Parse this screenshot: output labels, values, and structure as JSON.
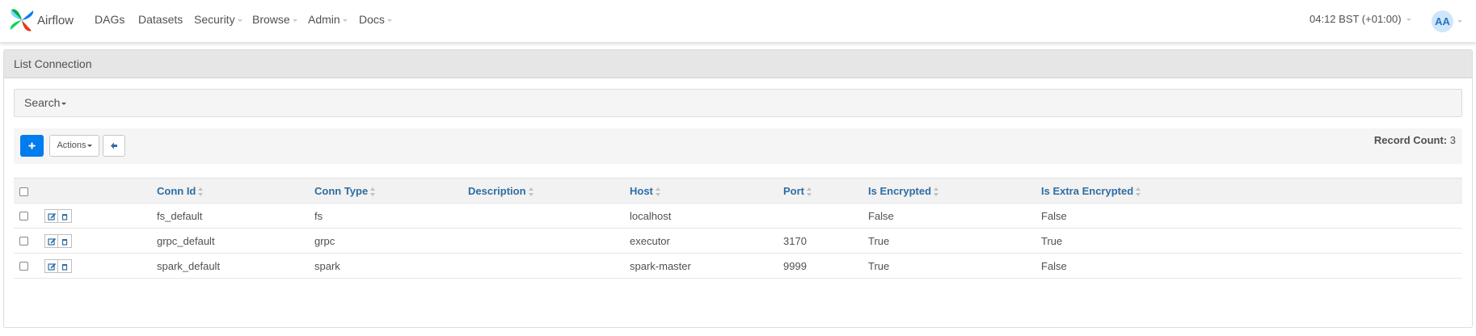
{
  "app": {
    "brand": "Airflow",
    "accent_color": "#017cee"
  },
  "nav": {
    "items": [
      {
        "label": "DAGs",
        "dropdown": false
      },
      {
        "label": "Datasets",
        "dropdown": false
      },
      {
        "label": "Security",
        "dropdown": true
      },
      {
        "label": "Browse",
        "dropdown": true
      },
      {
        "label": "Admin",
        "dropdown": true
      },
      {
        "label": "Docs",
        "dropdown": true
      }
    ],
    "clock": "04:12 BST (+01:00)",
    "user_initials": "AA"
  },
  "panel": {
    "title": "List Connection"
  },
  "search": {
    "label": "Search"
  },
  "toolbar": {
    "add_icon": "plus-icon",
    "actions_label": "Actions",
    "back_icon": "arrow-left-icon",
    "record_count_label": "Record Count:",
    "record_count_value": "3"
  },
  "table": {
    "columns": [
      "Conn Id",
      "Conn Type",
      "Description",
      "Host",
      "Port",
      "Is Encrypted",
      "Is Extra Encrypted"
    ],
    "rows": [
      [
        "fs_default",
        "fs",
        "",
        "localhost",
        "",
        "False",
        "False"
      ],
      [
        "grpc_default",
        "grpc",
        "",
        "executor",
        "3170",
        "True",
        "True"
      ],
      [
        "spark_default",
        "spark",
        "",
        "spark-master",
        "9999",
        "True",
        "False"
      ]
    ],
    "row_action_icons": [
      "edit-icon",
      "trash-icon"
    ]
  }
}
